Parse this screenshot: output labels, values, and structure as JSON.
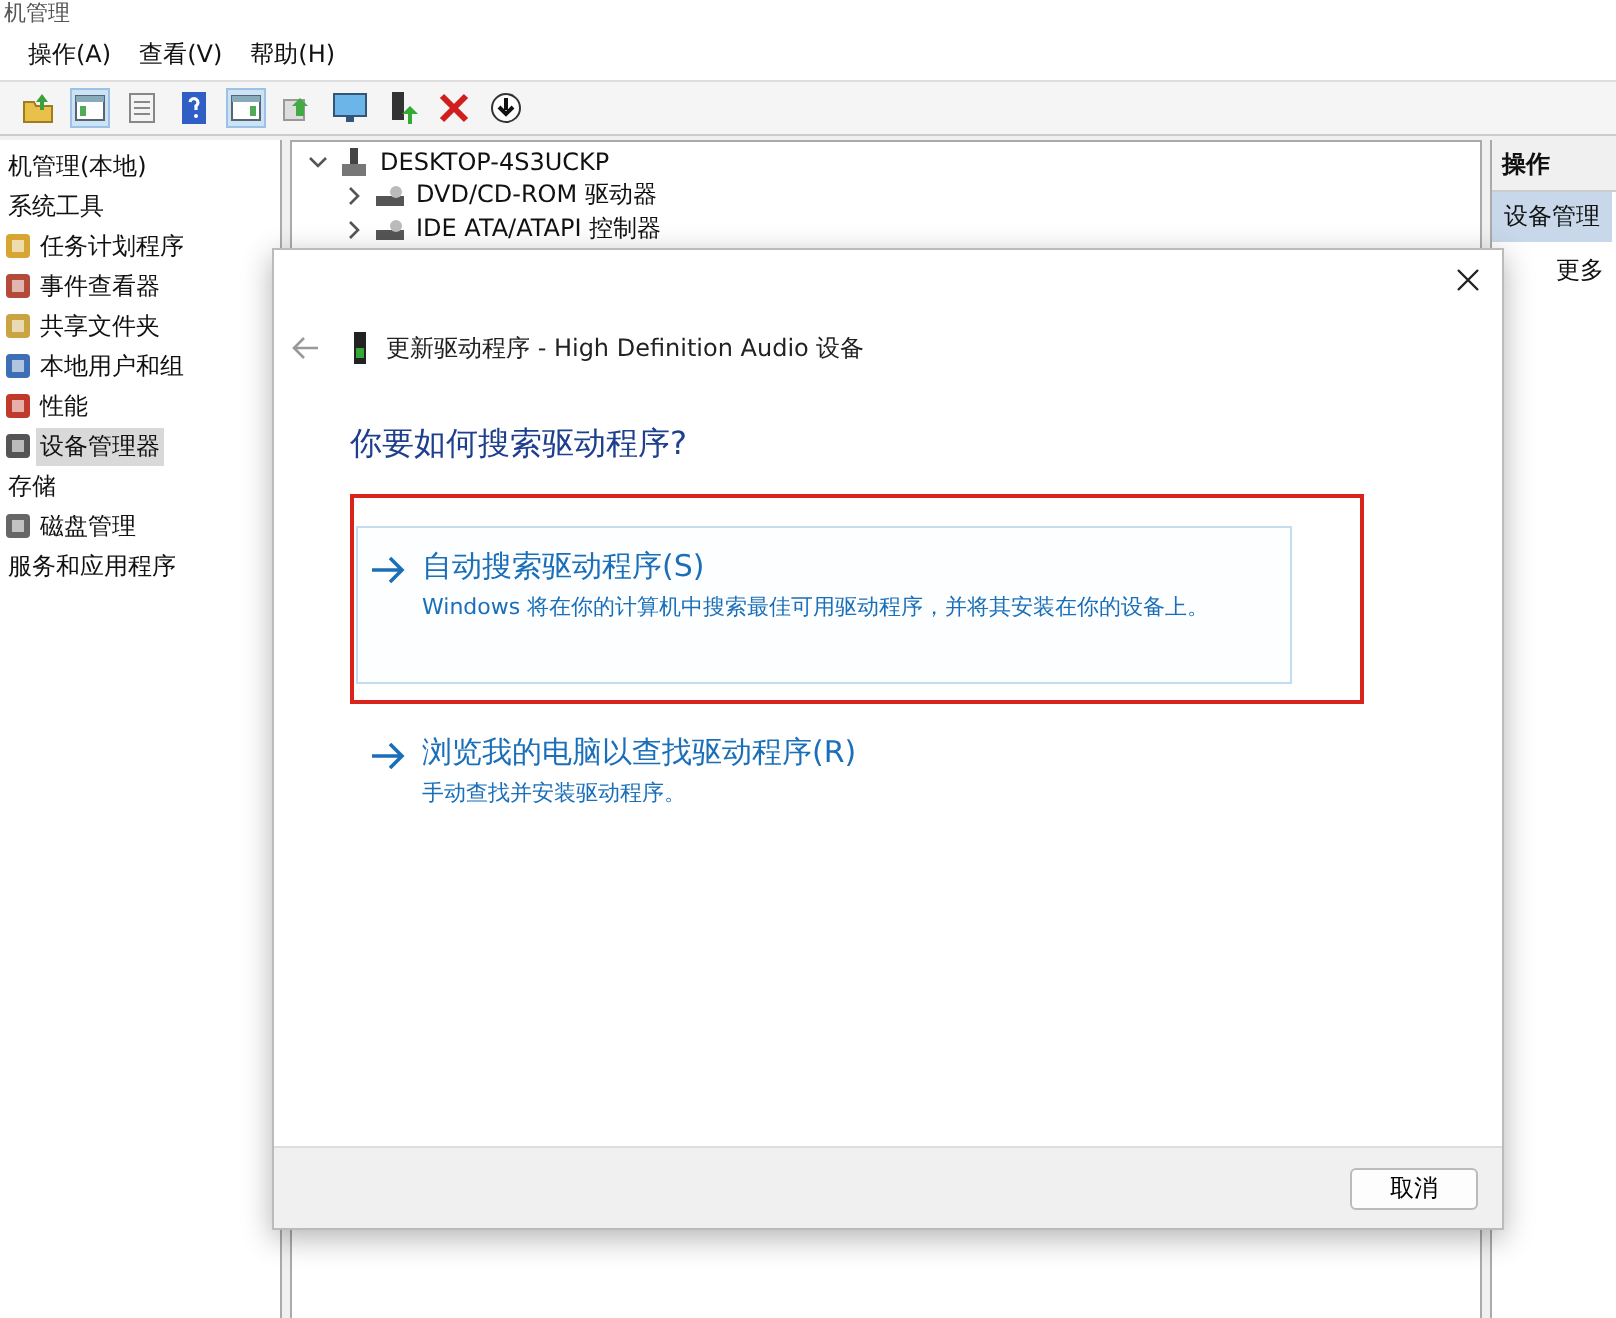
{
  "window": {
    "title": "机管理"
  },
  "menu": [
    "操作(A)",
    "查看(V)",
    "帮助(H)"
  ],
  "tree": [
    {
      "label": "机管理(本地)",
      "selected": false,
      "children": [
        {
          "label": "系统工具",
          "selected": false,
          "children": [
            {
              "label": "任务计划程序",
              "selected": false
            },
            {
              "label": "事件查看器",
              "selected": false
            },
            {
              "label": "共享文件夹",
              "selected": false
            },
            {
              "label": "本地用户和组",
              "selected": false
            },
            {
              "label": "性能",
              "selected": false
            },
            {
              "label": "设备管理器",
              "selected": true
            }
          ]
        },
        {
          "label": "存储",
          "selected": false,
          "children": [
            {
              "label": "磁盘管理",
              "selected": false
            }
          ]
        },
        {
          "label": "服务和应用程序",
          "selected": false
        }
      ]
    }
  ],
  "device_tree": [
    {
      "label": "DESKTOP-4S3UCKP",
      "expanded": true,
      "children": [
        {
          "label": "DVD/CD-ROM 驱动器",
          "expanded": false
        },
        {
          "label": "IDE ATA/ATAPI 控制器",
          "expanded": false
        }
      ]
    }
  ],
  "actions": {
    "header": "操作",
    "section": "设备管理",
    "items": [
      "更多"
    ]
  },
  "dialog": {
    "title": "更新驱动程序 - High Definition Audio 设备",
    "heading": "你要如何搜索驱动程序?",
    "options": [
      {
        "title": "自动搜索驱动程序(S)",
        "description": "Windows 将在你的计算机中搜索最佳可用驱动程序，并将其安装在你的设备上。",
        "selected": true,
        "highlighted": true
      },
      {
        "title": "浏览我的电脑以查找驱动程序(R)",
        "description": "手动查找并安装驱动程序。",
        "selected": false,
        "highlighted": false
      }
    ],
    "buttons": [
      "取消"
    ]
  }
}
